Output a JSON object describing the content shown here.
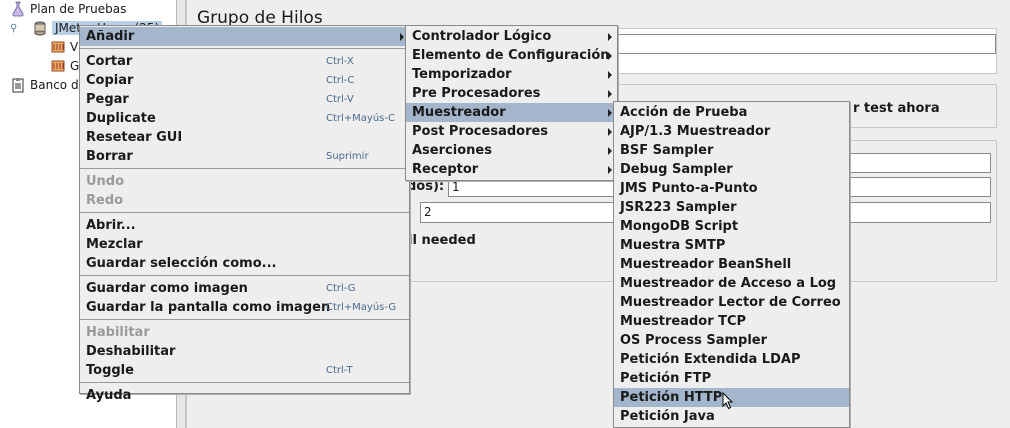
{
  "tree": {
    "items": [
      {
        "label": "Plan de Pruebas"
      },
      {
        "label": "JMeter Users (25)"
      },
      {
        "label": "V"
      },
      {
        "label": "G"
      },
      {
        "label": "Banco d"
      }
    ]
  },
  "panel": {
    "title": "Grupo de Hilos",
    "run_now_label": "r test ahora",
    "ramp_label": "dos):",
    "ramp_value": "1",
    "loop_value": "2",
    "delay_label": "il needed"
  },
  "menu_main": {
    "items": [
      {
        "label": "Añadir",
        "submenu": true,
        "highlighted": true
      },
      {
        "separator": true
      },
      {
        "label": "Cortar",
        "shortcut": "Ctrl-X"
      },
      {
        "label": "Copiar",
        "shortcut": "Ctrl-C"
      },
      {
        "label": "Pegar",
        "shortcut": "Ctrl-V"
      },
      {
        "label": "Duplicate",
        "shortcut": "Ctrl+Mayús-C"
      },
      {
        "label": "Resetear GUI"
      },
      {
        "label": "Borrar",
        "shortcut": "Suprimir"
      },
      {
        "separator": true
      },
      {
        "label": "Undo",
        "disabled": true
      },
      {
        "label": "Redo",
        "disabled": true
      },
      {
        "separator": true
      },
      {
        "label": "Abrir..."
      },
      {
        "label": "Mezclar"
      },
      {
        "label": "Guardar selección como..."
      },
      {
        "separator": true
      },
      {
        "label": "Guardar como imagen",
        "shortcut": "Ctrl-G"
      },
      {
        "label": "Guardar la pantalla como imagen",
        "shortcut": "Ctrl+Mayús-G"
      },
      {
        "separator": true
      },
      {
        "label": "Habilitar",
        "disabled": true
      },
      {
        "label": "Deshabilitar"
      },
      {
        "label": "Toggle",
        "shortcut": "Ctrl-T"
      },
      {
        "separator": true
      },
      {
        "label": "Ayuda"
      }
    ]
  },
  "menu_add": {
    "items": [
      {
        "label": "Controlador Lógico",
        "submenu": true
      },
      {
        "label": "Elemento de Configuración",
        "submenu": true
      },
      {
        "label": "Temporizador",
        "submenu": true
      },
      {
        "label": "Pre Procesadores",
        "submenu": true
      },
      {
        "label": "Muestreador",
        "submenu": true,
        "highlighted": true
      },
      {
        "label": "Post Procesadores",
        "submenu": true
      },
      {
        "label": "Aserciones",
        "submenu": true
      },
      {
        "label": "Receptor",
        "submenu": true
      }
    ]
  },
  "menu_sampler": {
    "items": [
      {
        "label": "Acción de Prueba"
      },
      {
        "label": "AJP/1.3 Muestreador"
      },
      {
        "label": "BSF Sampler"
      },
      {
        "label": "Debug Sampler"
      },
      {
        "label": "JMS Punto-a-Punto"
      },
      {
        "label": "JSR223 Sampler"
      },
      {
        "label": "MongoDB Script"
      },
      {
        "label": "Muestra SMTP"
      },
      {
        "label": "Muestreador BeanShell"
      },
      {
        "label": "Muestreador de Acceso a Log"
      },
      {
        "label": "Muestreador Lector de Correo"
      },
      {
        "label": "Muestreador TCP"
      },
      {
        "label": "OS Process Sampler"
      },
      {
        "label": "Petición Extendida LDAP"
      },
      {
        "label": "Petición FTP"
      },
      {
        "label": "Petición HTTP",
        "highlighted": true
      },
      {
        "label": "Petición Java"
      }
    ]
  },
  "colors": {
    "highlight": "#a4b6cc",
    "menu_bg": "#eeeeee",
    "shortcut": "#4a6a8a"
  }
}
